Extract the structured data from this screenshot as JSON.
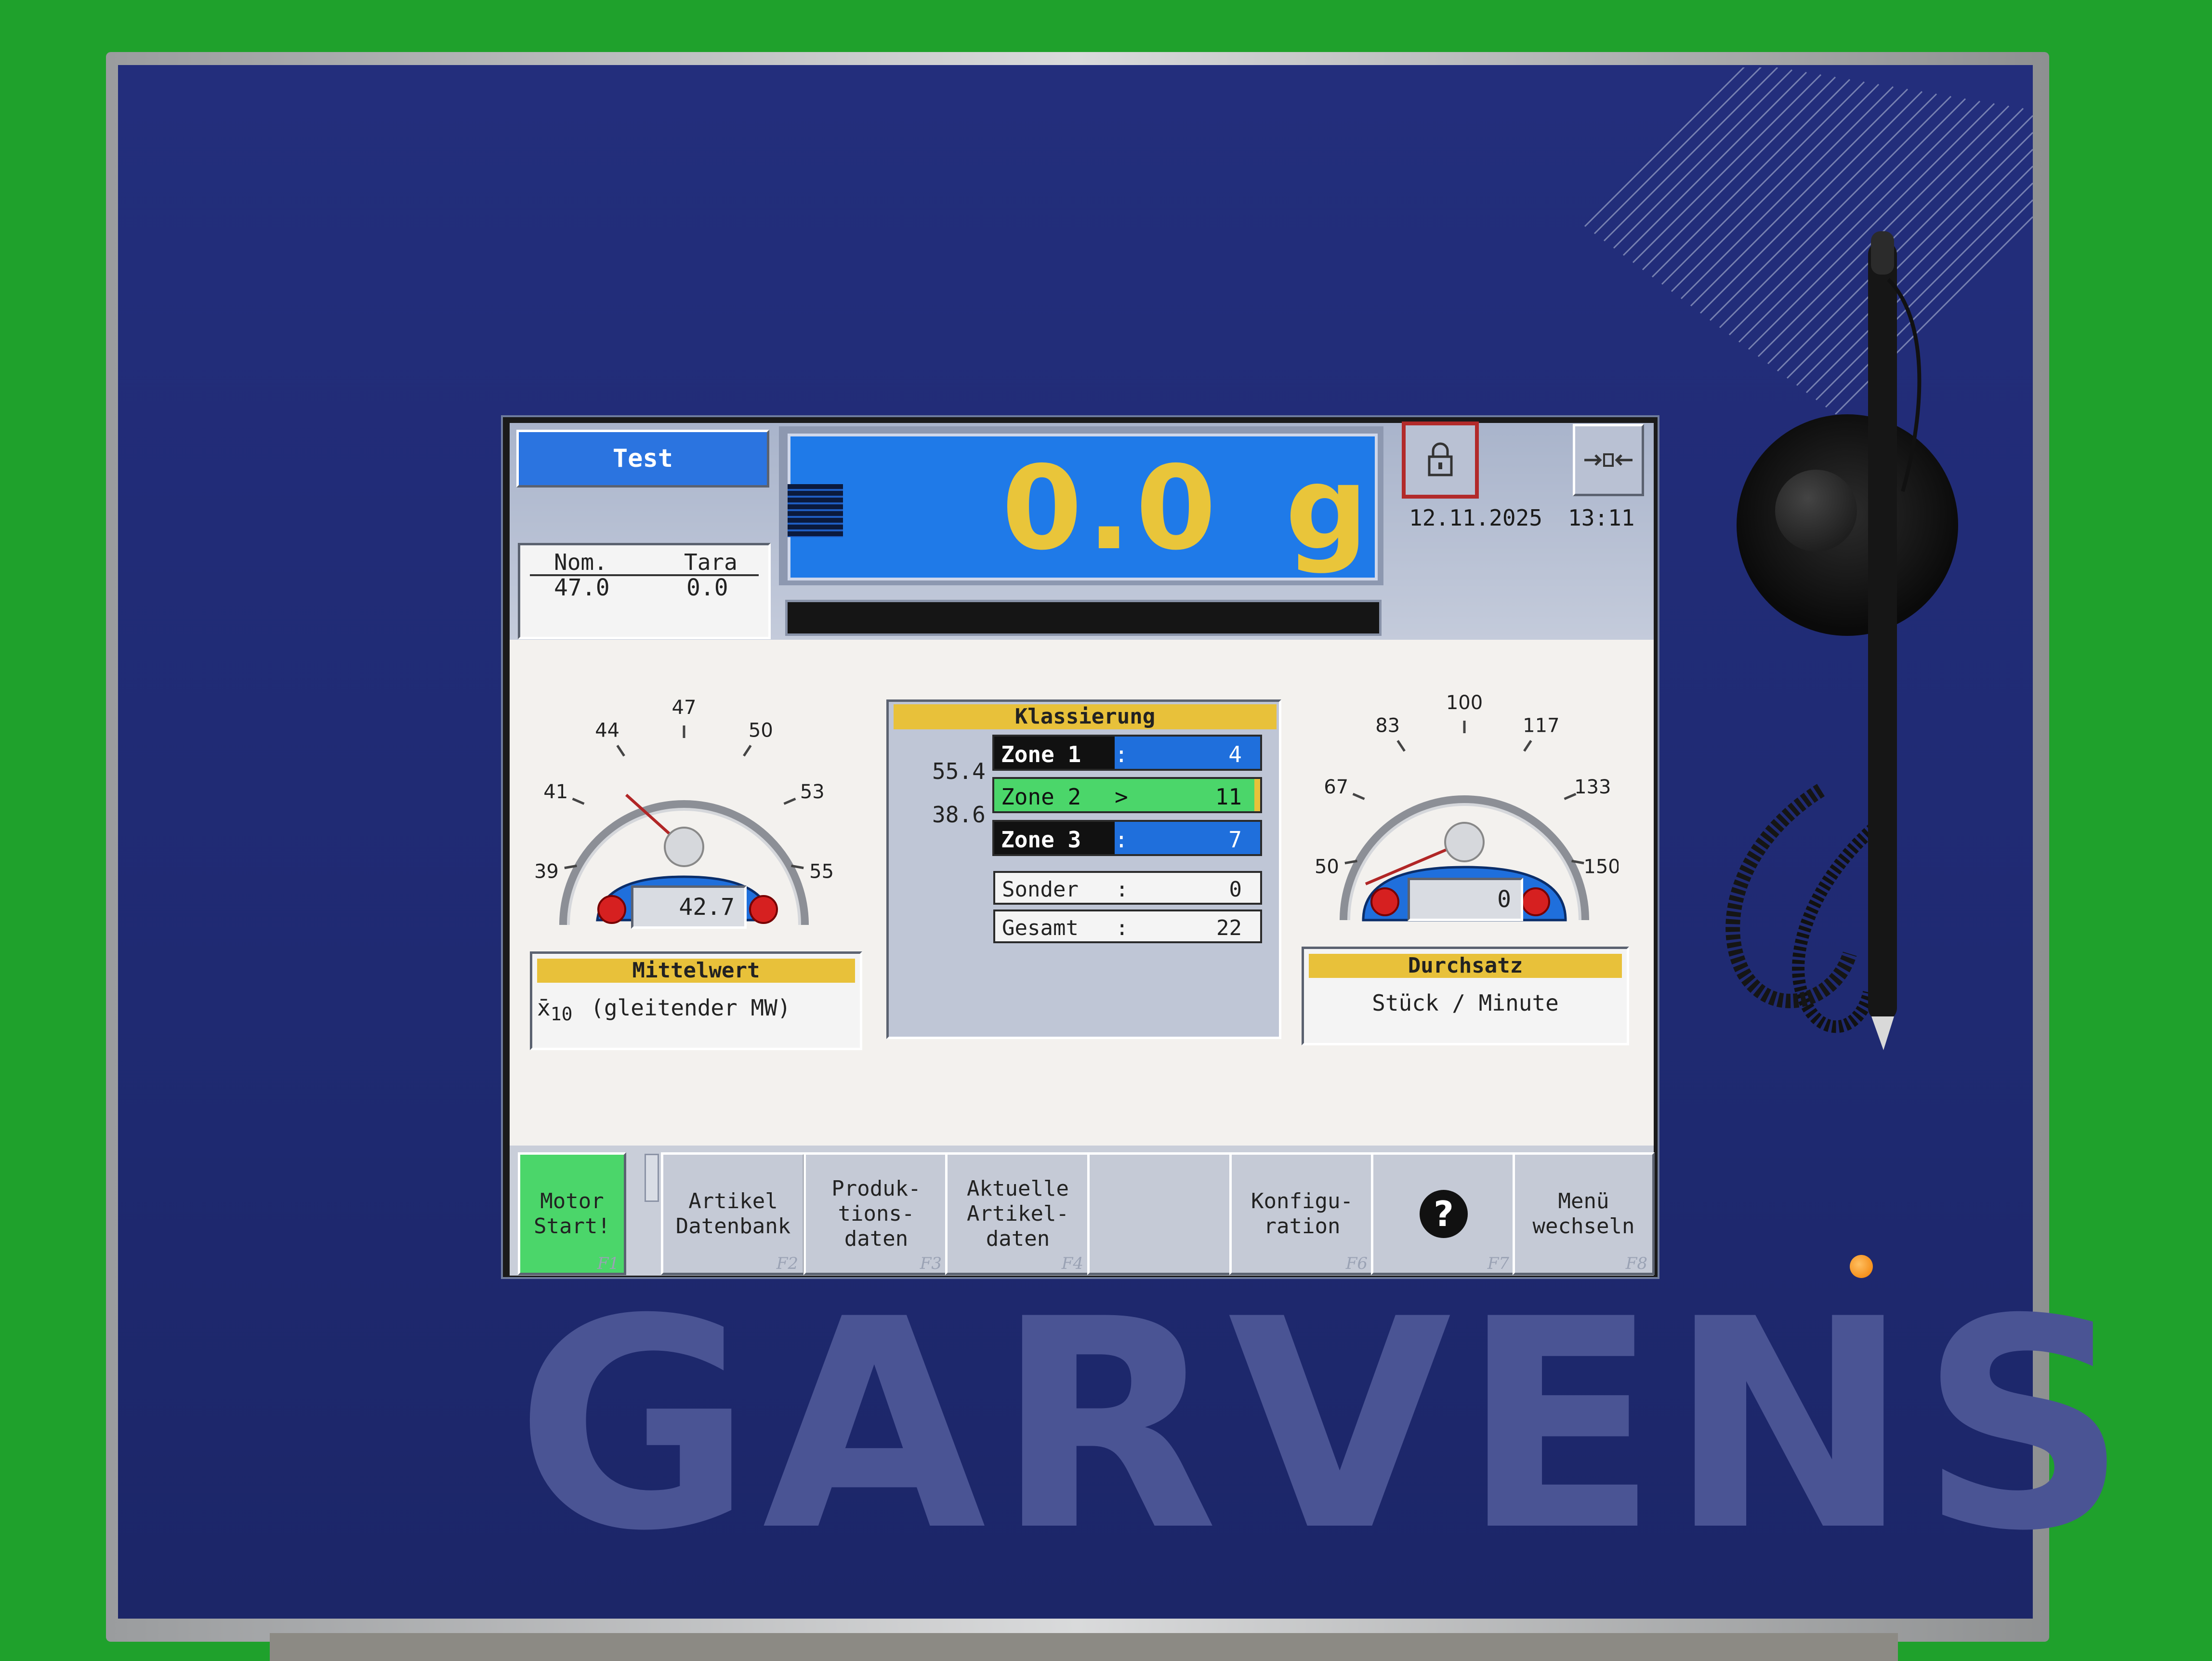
{
  "brand": "GARVENS",
  "header": {
    "product_label": "Test",
    "nominal_label": "Nom.",
    "nominal_value": "47.0",
    "tare_label": "Tara",
    "tare_value": "0.0",
    "weight_value": "0.0",
    "weight_unit": "g",
    "date": "12.11.2025",
    "time": "13:11",
    "lock_icon": "padlock-icon",
    "zero_icon": "arrows-inward-icon"
  },
  "gauges": {
    "mean": {
      "ticks": [
        "39",
        "41",
        "44",
        "47",
        "50",
        "53",
        "55"
      ],
      "value": "42.7",
      "title": "Mittelwert",
      "subtitle_symbol": "x̄",
      "subtitle_index": "10",
      "subtitle_text": "(gleitender MW)"
    },
    "throughput": {
      "ticks": [
        "50",
        "67",
        "83",
        "100",
        "117",
        "133",
        "150"
      ],
      "value": "0",
      "title": "Durchsatz",
      "subtitle_text": "Stück / Minute"
    }
  },
  "classification": {
    "title": "Klassierung",
    "limits": [
      "55.4",
      "38.6"
    ],
    "zones": [
      {
        "label": "Zone 1",
        "sep": ":",
        "count": "4"
      },
      {
        "label": "Zone 2",
        "sep": ">",
        "count": "11"
      },
      {
        "label": "Zone 3",
        "sep": ":",
        "count": "7"
      }
    ],
    "tallies": [
      {
        "label": "Sonder",
        "sep": ":",
        "count": "0"
      },
      {
        "label": "Gesamt",
        "sep": ":",
        "count": "22"
      }
    ]
  },
  "function_keys": [
    {
      "label": "Motor\nStart!",
      "fn": "F1"
    },
    {
      "label": "Artikel\nDatenbank",
      "fn": "F2"
    },
    {
      "label": "Produk-\ntions-\ndaten",
      "fn": "F3"
    },
    {
      "label": "Aktuelle\nArtikel-\ndaten",
      "fn": "F4"
    },
    {
      "label": "",
      "fn": ""
    },
    {
      "label": "Konfigu-\nration",
      "fn": "F6"
    },
    {
      "label": "?",
      "fn": "F7"
    },
    {
      "label": "Menü\nwechseln",
      "fn": "F8"
    }
  ],
  "colors": {
    "panel_blue": "#232e7c",
    "display_blue": "#1f7ae8",
    "digits_yellow": "#e9c53a",
    "header_yellow": "#e8c13a",
    "zone_active_green": "#4bd66a",
    "zone_bar_blue": "#1f6fdc",
    "motor_green": "#4bd66a"
  }
}
